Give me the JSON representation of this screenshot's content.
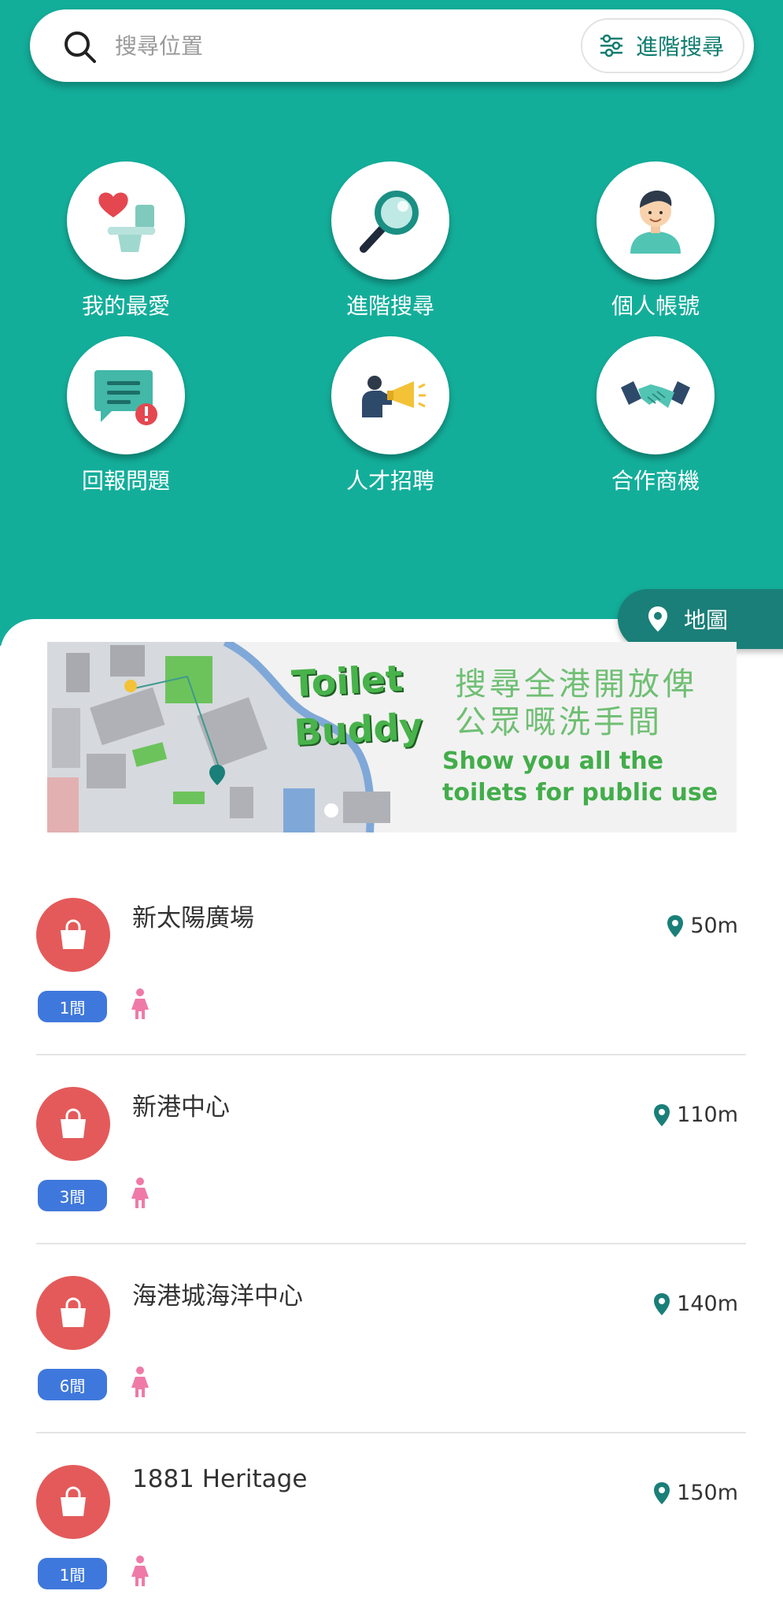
{
  "search": {
    "placeholder": "搜尋位置",
    "advanced_label": "進階搜尋"
  },
  "menu": [
    {
      "label": "我的最愛",
      "icon": "favorite-toilet-icon"
    },
    {
      "label": "進階搜尋",
      "icon": "magnifier-icon"
    },
    {
      "label": "個人帳號",
      "icon": "user-avatar-icon"
    },
    {
      "label": "回報問題",
      "icon": "report-chat-icon"
    },
    {
      "label": "人才招聘",
      "icon": "megaphone-icon"
    },
    {
      "label": "合作商機",
      "icon": "handshake-icon"
    }
  ],
  "map_button": {
    "label": "地圖",
    "icon": "location-pin-icon"
  },
  "banner": {
    "title_line1": "Toilet",
    "title_line2": "Buddy",
    "cn_line1": "搜尋全港開放俾",
    "cn_line2": "公眾嘅洗手間",
    "en_line1": "Show you all the",
    "en_line2": "toilets for public use"
  },
  "list": [
    {
      "name": "新太陽廣場",
      "distance": "50m",
      "count": "1間"
    },
    {
      "name": "新港中心",
      "distance": "110m",
      "count": "3間"
    },
    {
      "name": "海港城海洋中心",
      "distance": "140m",
      "count": "6間"
    },
    {
      "name": "1881 Heritage",
      "distance": "150m",
      "count": "1間"
    }
  ],
  "colors": {
    "primary": "#13ae9a",
    "dark_teal": "#1a7f78",
    "shop_red": "#e45a5a",
    "badge_blue": "#3f78dc",
    "female_pink": "#ef7aa8"
  }
}
